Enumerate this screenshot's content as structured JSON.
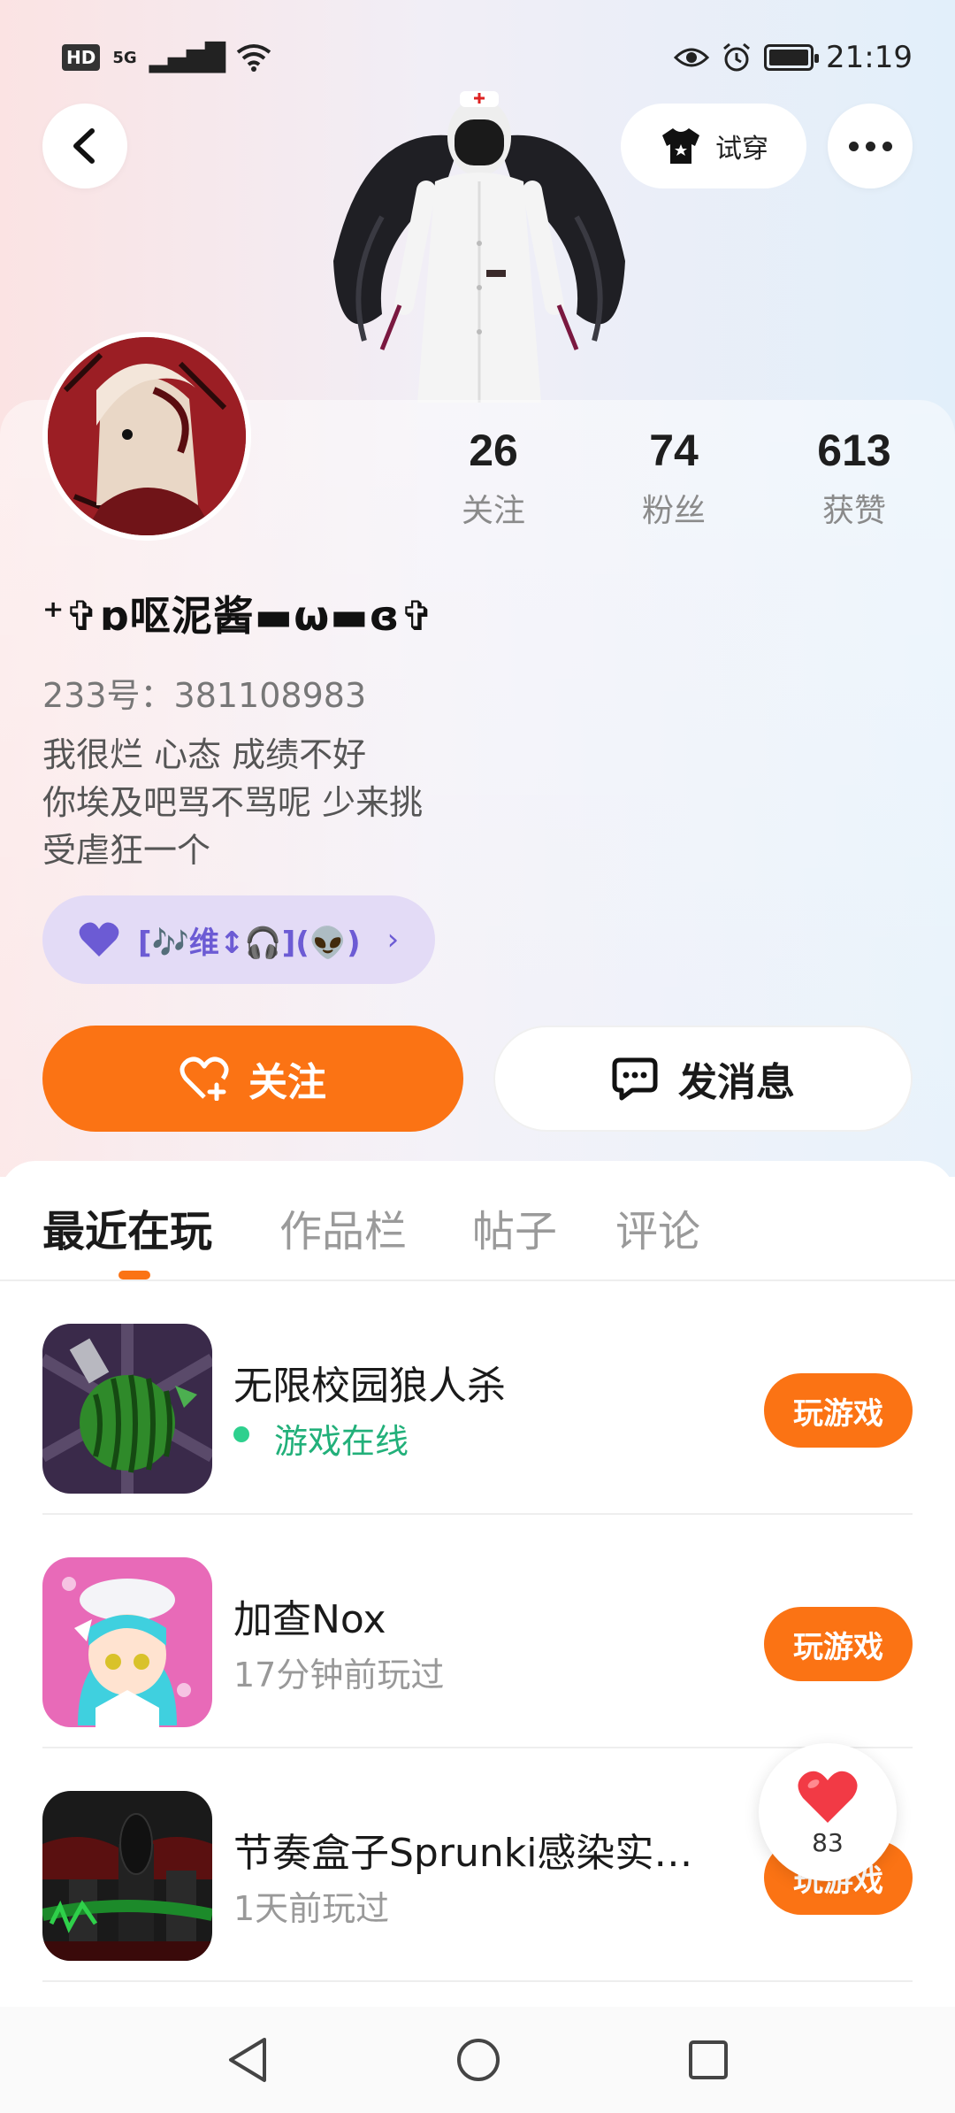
{
  "status_bar": {
    "left_badge": "HD",
    "network": "5G",
    "time": "21:19"
  },
  "header": {
    "tryon_label": "试穿"
  },
  "profile": {
    "stats": [
      {
        "value": "26",
        "label": "关注"
      },
      {
        "value": "74",
        "label": "粉丝"
      },
      {
        "value": "613",
        "label": "获赞"
      }
    ],
    "username": "⁺✞ɒ呕泥酱▬ω▬ɞ✞",
    "uid": "233号：381108983",
    "bio": [
      "我很烂 心态 成绩不好",
      "你埃及吧骂不骂呢 少来挑",
      "受虐狂一个"
    ],
    "tag_text": "[🎶维↕🎧](👽)",
    "follow_label": "关注",
    "message_label": "发消息"
  },
  "tabs": [
    "最近在玩",
    "作品栏",
    "帖子",
    "评论"
  ],
  "games": [
    {
      "title": "无限校园狼人杀",
      "sub": "游戏在线",
      "online": true,
      "button": "玩游戏"
    },
    {
      "title": "加查Nox",
      "sub": "17分钟前玩过",
      "online": false,
      "button": "玩游戏"
    },
    {
      "title": "节奏盒子Sprunki感染实…",
      "sub": "1天前玩过",
      "online": false,
      "button": "玩游戏"
    }
  ],
  "like_float": {
    "count": "83"
  },
  "colors": {
    "accent": "#fb7314",
    "online": "#22b07a",
    "tag_bg": "#e3dbf6"
  }
}
